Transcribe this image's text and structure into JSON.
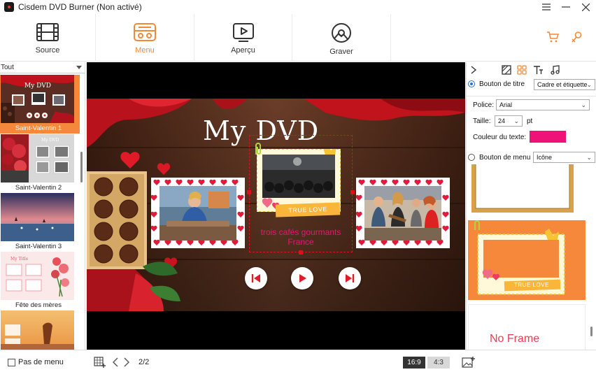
{
  "window": {
    "title": "Cisdem DVD Burner (Non activé)",
    "controls": [
      "menu-icon",
      "minimize-icon",
      "close-icon"
    ]
  },
  "toolbar": {
    "tabs": [
      {
        "label": "Source",
        "icon": "film-icon",
        "active": false
      },
      {
        "label": "Menu",
        "icon": "menu-template-icon",
        "active": true
      },
      {
        "label": "Aperçu",
        "icon": "play-screen-icon",
        "active": false
      },
      {
        "label": "Graver",
        "icon": "disc-icon",
        "active": false
      }
    ],
    "right_icons": [
      "cart-icon",
      "key-icon"
    ],
    "accent_color": "#f08a3a"
  },
  "templates": {
    "filter_value": "Tout",
    "items": [
      {
        "label": "Saint-Valentin 1",
        "thumb_title": "My DVD",
        "active": true
      },
      {
        "label": "Saint-Valentin 2",
        "active": false
      },
      {
        "label": "Saint-Valentin 3",
        "active": false
      },
      {
        "label": "Fête des mères",
        "thumb_title": "My Title",
        "active": false
      },
      {
        "label": "",
        "active": false
      }
    ]
  },
  "preview": {
    "dvd_title": "My DVD",
    "sticker_text": "TRUE LOVE",
    "caption_line1": "trois cafés gourmants",
    "caption_line2": "France",
    "caption_color": "#e61775",
    "nav_buttons": [
      "previous-icon",
      "play-icon",
      "next-icon"
    ]
  },
  "properties": {
    "tab_icons": [
      "expand-icon",
      "background-icon",
      "layout-icon",
      "text-icon",
      "music-icon"
    ],
    "title_button_label": "Bouton de titre",
    "title_button_selected": true,
    "title_button_style": "Cadre et étiquette",
    "font_label": "Police:",
    "font_value": "Arial",
    "size_label": "Taille:",
    "size_value": "24",
    "size_unit": "pt",
    "text_color_label": "Couleur du texte:",
    "text_color": "#ee1379",
    "menu_button_label": "Bouton de menu",
    "menu_button_selected": false,
    "menu_button_style": "Icône",
    "frames": [
      {
        "kind": "wooden-frame"
      },
      {
        "kind": "sticker-frame",
        "sticker_text": "TRUE LOVE",
        "selected": true
      },
      {
        "kind": "none",
        "label": "No Frame"
      }
    ]
  },
  "bottom": {
    "no_menu_label": "Pas de menu",
    "no_menu_checked": false,
    "page_indicator": "2/2",
    "ratio_options": [
      "16:9",
      "4:3"
    ],
    "ratio_active": "16:9"
  }
}
